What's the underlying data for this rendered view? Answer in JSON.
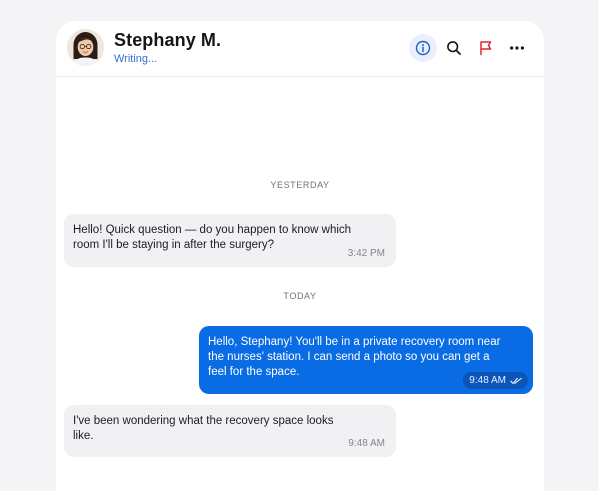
{
  "header": {
    "contact_name": "Stephany M.",
    "status": "Writing..."
  },
  "icons": {
    "info": "info-icon",
    "search": "search-icon",
    "flag": "flag-icon",
    "more": "more-icon"
  },
  "colors": {
    "accent": "#0a6ce4",
    "status_text": "#2f6fdb",
    "flag": "#e0262d"
  },
  "messages": {
    "sep_yesterday": "YESTERDAY",
    "sep_today": "TODAY",
    "m1_text": "Hello! Quick question — do you happen to know which\nroom I'll be staying in after the surgery?",
    "m1_time": "3:42 PM",
    "m2_text": "Hello, Stephany! You'll be in a private recovery room near\nthe nurses' station. I can send a photo so you can get a\nfeel for the space.",
    "m2_time": "9:48 AM",
    "m3_text": "I've been wondering what the recovery space looks\nlike.",
    "m3_time": "9:48 AM"
  }
}
